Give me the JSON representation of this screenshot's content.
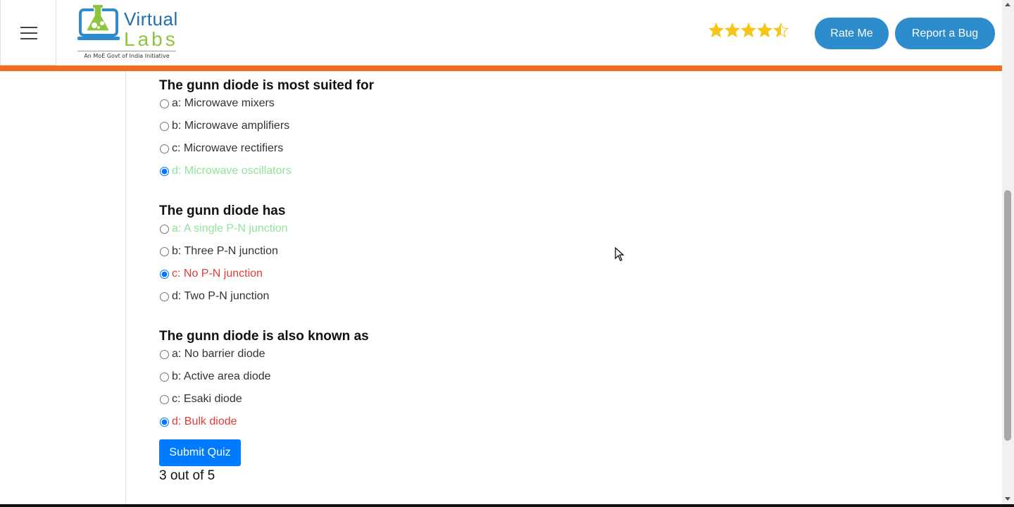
{
  "header": {
    "logo_line1": "Virtual",
    "logo_line2": "Labs",
    "logo_tagline": "An MoE Govt of India Initiative",
    "rating_stars": 4.5,
    "rate_button": "Rate Me",
    "bug_button": "Report a Bug"
  },
  "colors": {
    "accent_orange": "#f36c1b",
    "pill_blue": "#2d8ccc",
    "submit_blue": "#007bff",
    "correct_green": "#90e39a",
    "wrong_red": "#e53935",
    "star_gold": "#f5c518"
  },
  "questions": [
    {
      "title": "The gunn diode is most suited for",
      "options": [
        {
          "label": "a: Microwave mixers",
          "state": "normal",
          "checked": false
        },
        {
          "label": "b: Microwave amplifiers",
          "state": "normal",
          "checked": false
        },
        {
          "label": "c: Microwave rectifiers",
          "state": "normal",
          "checked": false
        },
        {
          "label": "d: Microwave oscillators",
          "state": "correct",
          "checked": true
        }
      ]
    },
    {
      "title": "The gunn diode has",
      "options": [
        {
          "label": "a: A single P-N junction",
          "state": "correct",
          "checked": false
        },
        {
          "label": "b: Three P-N junction",
          "state": "normal",
          "checked": false
        },
        {
          "label": "c: No P-N junction",
          "state": "wrong",
          "checked": true
        },
        {
          "label": "d: Two P-N junction",
          "state": "normal",
          "checked": false
        }
      ]
    },
    {
      "title": "The gunn diode is also known as",
      "options": [
        {
          "label": "a: No barrier diode",
          "state": "normal",
          "checked": false
        },
        {
          "label": "b: Active area diode",
          "state": "normal",
          "checked": false
        },
        {
          "label": "c: Esaki diode",
          "state": "normal",
          "checked": false
        },
        {
          "label": "d: Bulk diode",
          "state": "wrong",
          "checked": true
        }
      ]
    }
  ],
  "submit_label": "Submit Quiz",
  "score_text": "3 out of 5"
}
